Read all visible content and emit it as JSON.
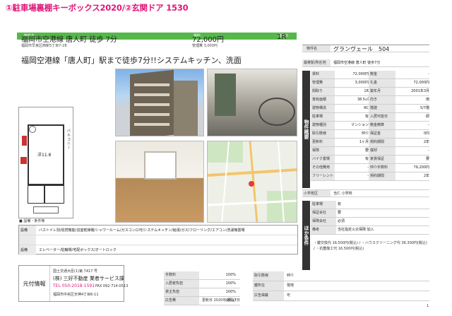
{
  "header": {
    "title": "①駐車場裏棚キーボックス2020/②玄関ドア 1530"
  },
  "summary": {
    "bar_labels": {
      "name": "物件名",
      "price": "賃料",
      "layout": "間取り"
    },
    "address_line": "福岡市空港線 唐人町 徒歩 7分",
    "address_sub": "福岡市早良区西新5丁目7-28",
    "price_line": "72,000円",
    "price_sub": "管理費 3,000円",
    "layout_line": "1R"
  },
  "catch_copy": "福岡空港線「唐人町」駅まで徒歩7分!!システムキッチン、洗面",
  "floorplan": {
    "room_label": "洋11.8",
    "balcony_label": "バルコニー"
  },
  "property": {
    "name_label": "物件名",
    "name_value": "グランヴェール　504",
    "location_label": "最寄駅/所在地",
    "location_value": "福岡市空港線 唐人町 徒歩7分",
    "section_left": "物件概要",
    "rows": [
      [
        "賃料",
        "72,000円",
        "敷金",
        "-"
      ],
      [
        "管理費",
        "3,000円",
        "礼金",
        "72,000円"
      ],
      [
        "間取り",
        "1R",
        "築年月",
        "2001年3月"
      ],
      [
        "専有面積",
        "38.5㎡",
        "向き",
        "南"
      ],
      [
        "建物構造",
        "RC",
        "階建",
        "5/7階"
      ],
      [
        "駐車場",
        "有",
        "入居可能日",
        "即"
      ],
      [
        "建物種別",
        "マンション",
        "敷金精算",
        "-"
      ],
      [
        "取引態様",
        "仲介",
        "保証金",
        "0円"
      ],
      [
        "更新料",
        "1ヶ月",
        "契約期間",
        "2年"
      ],
      [
        "保険",
        "要",
        "償却",
        "-"
      ],
      [
        "バイク置場",
        "有",
        "家賃保証",
        "要"
      ],
      [
        "その他費用",
        "-",
        "仲介手数料",
        "79,200円"
      ],
      [
        "フリーレント",
        "-",
        "契約期間",
        "2年"
      ]
    ],
    "school_label": "小学校区",
    "school_value": "当仁 小学校",
    "section_right": "ほか条件",
    "cond_rows": [
      [
        "駐車場",
        "有"
      ],
      [
        "保証会社",
        "要"
      ],
      [
        "保険会社",
        "必須"
      ],
      [
        "備考",
        "当社指定火災保険 加入"
      ]
    ],
    "notes": "・鍵交換代 16,500円(税込) / ・ハウスクリーニング代 36,300円(税込) / ・抗菌施工代 16,500円(税込)"
  },
  "equipment": {
    "header": "■ 設備・条件等",
    "rows": [
      {
        "label": "設備",
        "value": "バストイレ別/追焚機能/浴室乾燥機/シャワールーム/ガスコンロ可/システムキッチン/給湯/ガス/フローリング/エアコン/洗濯機置場"
      },
      {
        "label": "",
        "value": ""
      },
      {
        "label": "設備",
        "value": "エレベーター/駐輪場/宅配ボックス/オートロック"
      }
    ]
  },
  "footer": {
    "section": "元付情報",
    "license": "国土交通大臣(1)第 7417 号",
    "company": "(株) 三好不動産 業者サービス課",
    "tel": "TEL 050-2018-1591",
    "fax": "FAX 092-714-0513",
    "address": "福岡市中央区天神4丁目6-11",
    "fee_rows": [
      {
        "label": "手数料",
        "value": "100%"
      },
      {
        "label": "入居者負担",
        "value": "100%"
      },
      {
        "label": "貸主負担",
        "value": "100%"
      },
      {
        "label": "広告費",
        "value": "(税込)"
      }
    ],
    "right_rows": [
      {
        "label": "取引態様",
        "value": "仲介"
      },
      {
        "label": "鍵所在",
        "value": "現地"
      },
      {
        "label": "広告掲載",
        "value": "可"
      }
    ],
    "date_line": "更新日 2020年2月17日",
    "page_num": "1"
  },
  "colors": {
    "accent": "#e0187a",
    "bar": "#56b84a"
  }
}
